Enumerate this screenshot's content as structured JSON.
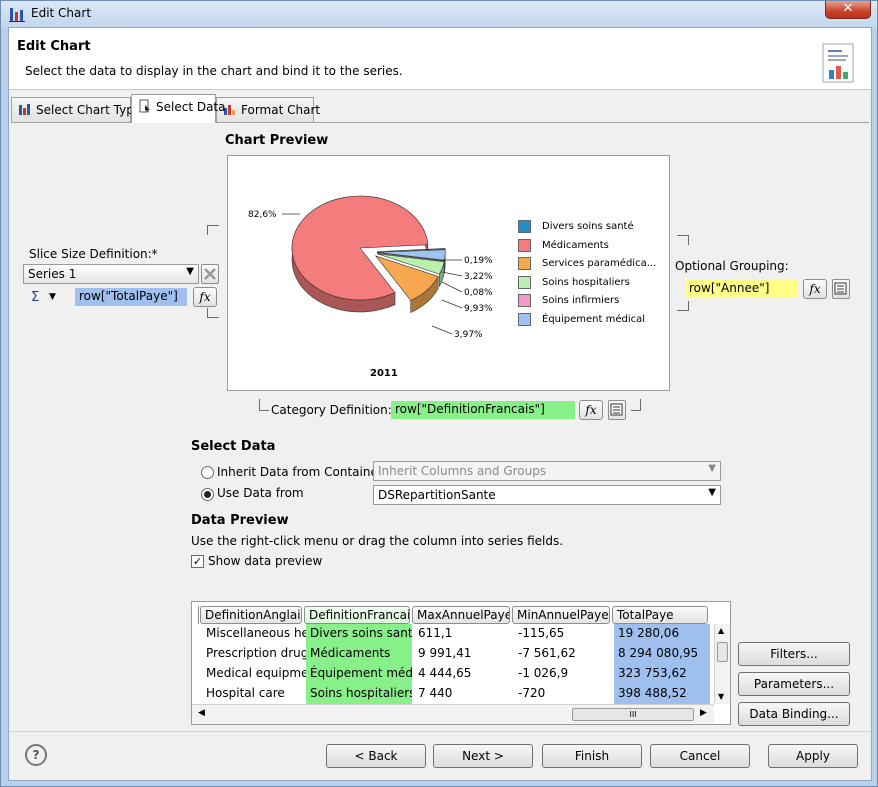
{
  "window": {
    "title": "Edit Chart",
    "close_label": "✕"
  },
  "header": {
    "title": "Edit Chart",
    "description": "Select the data to display in the chart and bind it to the series."
  },
  "tabs": [
    {
      "label": "Select Chart Type"
    },
    {
      "label": "Select Data"
    },
    {
      "label": "Format Chart"
    }
  ],
  "preview": {
    "title": "Chart Preview",
    "pie_caption": "2011"
  },
  "slice_size": {
    "label": "Slice Size Definition:*",
    "series_value": "Series 1",
    "aggregate_symbol": "Σ",
    "expression": "row[\"TotalPaye\"]"
  },
  "optional_grouping": {
    "label": "Optional Grouping:",
    "expression": "row[\"Annee\"]"
  },
  "category": {
    "label": "Category Definition:*",
    "expression": "row[\"DefinitionFrancais\"]"
  },
  "fx_label": "fx",
  "select_data": {
    "title": "Select Data",
    "inherit_label": "Inherit Data from Container",
    "inherit_value": "Inherit Columns and Groups",
    "use_label": "Use Data from",
    "use_value": "DSRepartitionSante"
  },
  "data_preview": {
    "title": "Data Preview",
    "hint": "Use the right-click menu or drag the column into series fields.",
    "show_label": "Show data preview",
    "columns": [
      "DefinitionAnglais",
      "DefinitionFrancais",
      "MaxAnnuelPaye",
      "MinAnnuelPaye",
      "TotalPaye"
    ],
    "rows": [
      [
        "Miscellaneous healt",
        "Divers soins santé",
        "611,1",
        "-115,65",
        "19 280,06"
      ],
      [
        "Prescription drugs",
        "Médicaments",
        "9 991,41",
        "-7 561,62",
        "8 294 080,95"
      ],
      [
        "Medical equipment",
        "Équipement médica",
        "4 444,65",
        "-1 026,9",
        "323 753,62"
      ],
      [
        "Hospital care",
        "Soins hospitaliers",
        "7 440",
        "-720",
        "398 488,52"
      ]
    ],
    "scroll_thumb": "III"
  },
  "side_buttons": {
    "filters": "Filters...",
    "parameters": "Parameters...",
    "binding": "Data Binding..."
  },
  "footer": {
    "help": "?",
    "back": "< Back",
    "next": "Next >",
    "finish": "Finish",
    "cancel": "Cancel",
    "apply": "Apply"
  },
  "chart_data": {
    "type": "pie",
    "title": "",
    "caption": "2011",
    "categories": [
      "Divers soins santé",
      "Médicaments",
      "Services paramédica...",
      "Soins hospitaliers",
      "Soins infirmiers",
      "Équipement médical"
    ],
    "values": [
      0.19,
      82.6,
      9.93,
      3.97,
      0.08,
      3.22
    ],
    "value_labels": [
      "0,19%",
      "82,6%",
      "9,93%",
      "3,97%",
      "0,08%",
      "3,22%"
    ],
    "colors": [
      "#1f8fc4",
      "#f47c7c",
      "#f7a84f",
      "#b9f0b0",
      "#f59ac8",
      "#9fc3f2"
    ],
    "legend_position": "right"
  }
}
